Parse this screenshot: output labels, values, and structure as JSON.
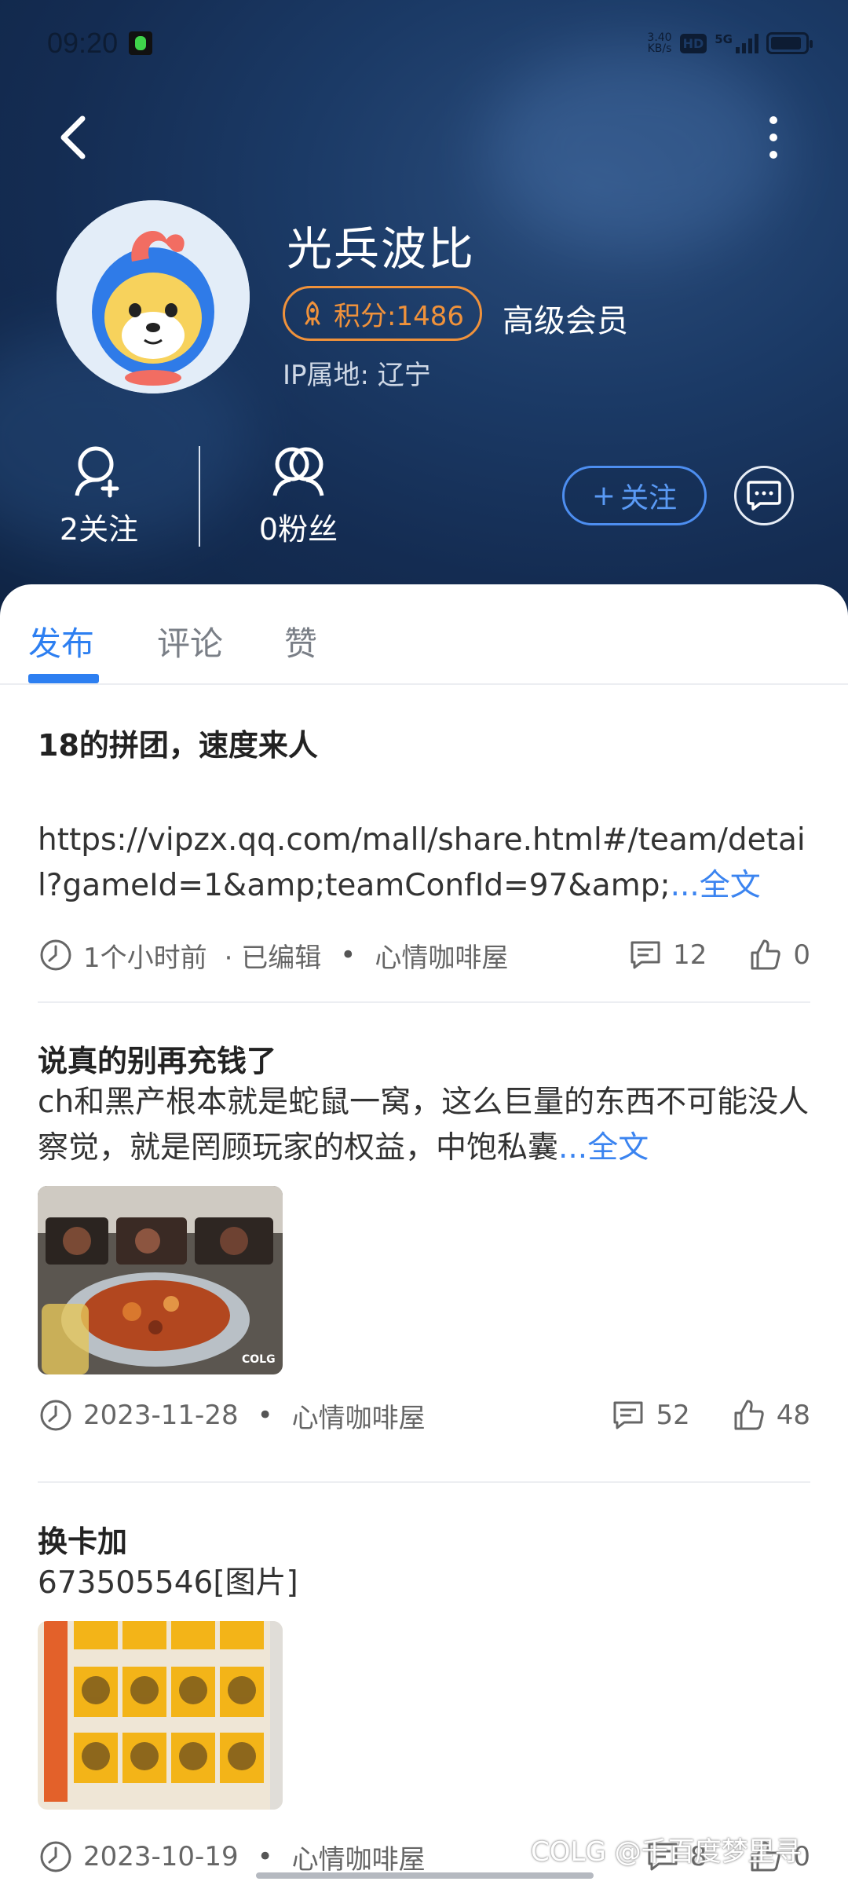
{
  "status_bar": {
    "time": "09:20",
    "net_speed": "3.40\nKB/s",
    "hd": "HD",
    "signal": "5G"
  },
  "profile": {
    "username": "光兵波比",
    "points": "积分:1486",
    "member_level": "高级会员",
    "ip_location": "IP属地: 辽宁",
    "following": "2关注",
    "followers": "0粉丝",
    "follow_button": "关注"
  },
  "tabs": [
    {
      "label": "发布",
      "active": true
    },
    {
      "label": "评论",
      "active": false
    },
    {
      "label": "赞",
      "active": false
    }
  ],
  "posts": [
    {
      "title": "18的拼团，速度来人",
      "body": "https://vipzx.qq.com/mall/share.html#/team/detail?gameId=1&amp;teamConfId=97&amp;",
      "more": "...全文",
      "time": "1个小时前",
      "edited": "· 已编辑",
      "board": "心情咖啡屋",
      "comments": "12",
      "likes": "0"
    },
    {
      "title": "说真的别再充钱了",
      "body": "ch和黑产根本就是蛇鼠一窝，这么巨量的东西不可能没人察觉，就是罔顾玩家的权益，中饱私囊",
      "more": "...全文",
      "image": "food-photo",
      "time": "2023-11-28",
      "board": "心情咖啡屋",
      "comments": "52",
      "likes": "48"
    },
    {
      "title": "换卡加",
      "body": "673505546[图片]",
      "image": "card-grid-image",
      "time": "2023-10-19",
      "board": "心情咖啡屋",
      "comments": "8",
      "likes": "0"
    }
  ],
  "watermark": "COLG @千百度梦里寻",
  "colors": {
    "accent": "#2d7ff1",
    "points": "#f0923b",
    "header_bg": "#1b3a66"
  }
}
